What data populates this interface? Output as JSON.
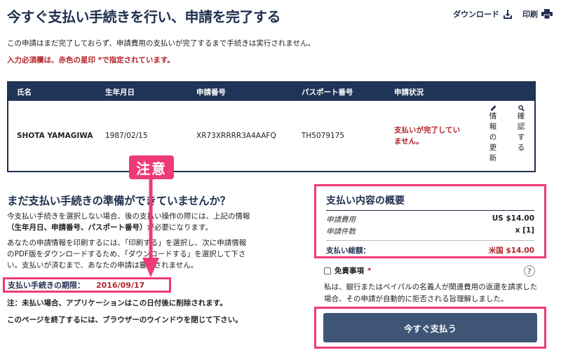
{
  "page_title": "今すぐ支払い手続きを行い、申請を完了する",
  "actions": {
    "download": "ダウンロード",
    "print": "印刷"
  },
  "notes": {
    "incomplete": "この申請はまだ完了しておらず、申請費用の支払いが完了するまで手続きは実行されません。",
    "required": "入力必須欄は、赤色の星印 *で指定されています。"
  },
  "table": {
    "headers": [
      "氏名",
      "生年月日",
      "申請番号",
      "パスポート番号",
      "申請状況"
    ],
    "row": {
      "name": "SHOTA YAMAGIWA",
      "dob": "1987/02/15",
      "app_no": "XR73XRRRR3A4AAFQ",
      "passport": "TH5079175",
      "status_line1": "支払いが完了してい",
      "status_line2": "ません。"
    },
    "update_label": "情報の更新",
    "check_label": "確認する"
  },
  "annotation": {
    "attention": "注意"
  },
  "left": {
    "title": "まだ支払い手続きの準備ができていませんか？",
    "p1_line1": "今支払い手続きを選択しない場合、後の支払い操作の際には、上記の情報",
    "p1_bold": "（生年月日、申請番号、パスポート番号）",
    "p1_tail": "が必要になります。",
    "p2_line1": "あなたの申請情報を印刷するには、「印刷する」を選択し、次に申請情報",
    "p2_line2": "のPDF版をダウンロードするため、「ダウンロードする」を選択して下さ",
    "p2_line3": "い。支払いが済むまで、あなたの申請は審査されません。",
    "deadline_label": "支払い手続きの期限：",
    "deadline_value": "2016/09/17",
    "deletion_note": "注：未払い場合、アプリケーションはこの日付後に削除されます。",
    "close_note": "このページを終了するには、ブラウザーのウインドウを閉じて下さい。"
  },
  "summary": {
    "title": "支払い内容の概要",
    "fee_label": "申請費用",
    "fee_value": "US $14.00",
    "count_label": "申請件数",
    "count_value": "x [1]",
    "total_label": "支払い総額：",
    "total_value": "米国 $14.00"
  },
  "disclaimer": {
    "label": "免責事項",
    "required_mark": "*",
    "help": "?",
    "text": "私は、銀行またはペイパルの名義人が関連費用の返還を請求した場合、その申請が自動的に拒否される旨理解しました。"
  },
  "pay_button": "今すぐ支払う",
  "colors": {
    "navy": "#1f3557",
    "accent_pink": "#ee3b77",
    "error_red": "#b3242a",
    "button": "#3e5575"
  }
}
